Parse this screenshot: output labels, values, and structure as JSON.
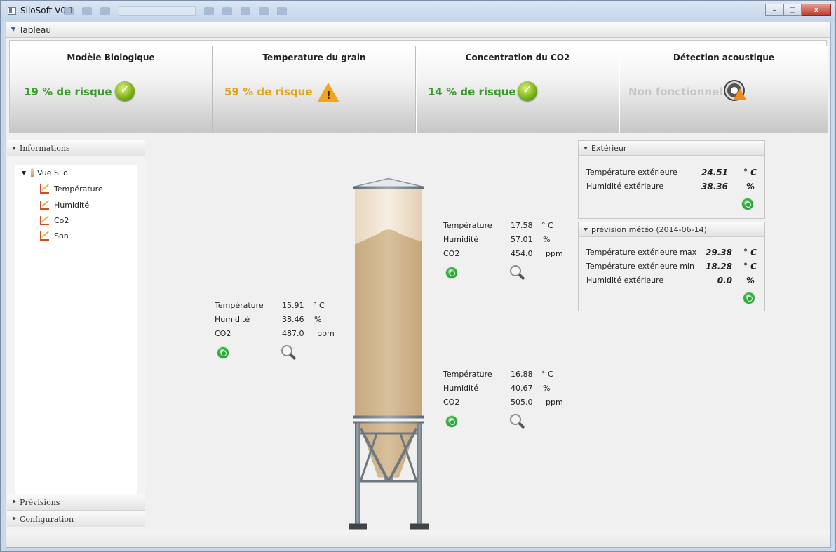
{
  "window": {
    "title": "SiloSoft V0.1",
    "controls": {
      "minimize": "–",
      "maximize": "□",
      "close": "x"
    }
  },
  "tableau": {
    "label": "Tableau",
    "cards": [
      {
        "title": "Modèle Biologique",
        "value": "19 % de risque",
        "color": "#3a9b2a",
        "icon": "check-icon"
      },
      {
        "title": "Temperature du grain",
        "value": "59 % de risque",
        "color": "#e0a41b",
        "icon": "warning-icon"
      },
      {
        "title": "Concentration du CO2",
        "value": "14 % de risque",
        "color": "#3a9b2a",
        "icon": "check-icon"
      },
      {
        "title": "Détection acoustique",
        "value": "Non fonctionnel",
        "color": "#c7c7c7",
        "icon": "speaker-warning-icon"
      }
    ]
  },
  "sidebar": {
    "informations_label": "Informations",
    "tree": {
      "root": "Vue Silo",
      "items": [
        "Température",
        "Humidité",
        "Co2",
        "Son"
      ]
    },
    "previsions_label": "Prévisions",
    "configuration_label": "Configuration"
  },
  "sensors": {
    "left": {
      "temp_label": "Température",
      "temp_value": "15.91",
      "temp_unit": "° C",
      "hum_label": "Humidité",
      "hum_value": "38.46",
      "hum_unit": "%",
      "co2_label": "CO2",
      "co2_value": "487.0",
      "co2_unit": "ppm"
    },
    "top_right": {
      "temp_label": "Température",
      "temp_value": "17.58",
      "temp_unit": "° C",
      "hum_label": "Humidité",
      "hum_value": "57.01",
      "hum_unit": "%",
      "co2_label": "CO2",
      "co2_value": "454.0",
      "co2_unit": "ppm"
    },
    "bottom_right": {
      "temp_label": "Température",
      "temp_value": "16.88",
      "temp_unit": "° C",
      "hum_label": "Humidité",
      "hum_value": "40.67",
      "hum_unit": "%",
      "co2_label": "CO2",
      "co2_value": "505.0",
      "co2_unit": "ppm"
    }
  },
  "exterieur": {
    "label": "Extérieur",
    "temp_label": "Température extérieure",
    "temp_value": "24.51",
    "temp_unit": "° C",
    "hum_label": "Humidité extérieure",
    "hum_value": "38.36",
    "hum_unit": "%"
  },
  "meteo": {
    "label": "prévision météo (2014-06-14)",
    "tmax_label": "Température extérieure max",
    "tmax_value": "29.38",
    "tmax_unit": "° C",
    "tmin_label": "Température extérieure min",
    "tmin_value": "18.28",
    "tmin_unit": "° C",
    "hum_label": "Humidité extérieure",
    "hum_value": "0.0",
    "hum_unit": "%"
  },
  "colors": {
    "accent": "#2a6ebb",
    "ok_green": "#3a9b2a",
    "warning_orange": "#e0a41b",
    "disabled_gray": "#c7c7c7",
    "grain": "#cdb18c"
  }
}
